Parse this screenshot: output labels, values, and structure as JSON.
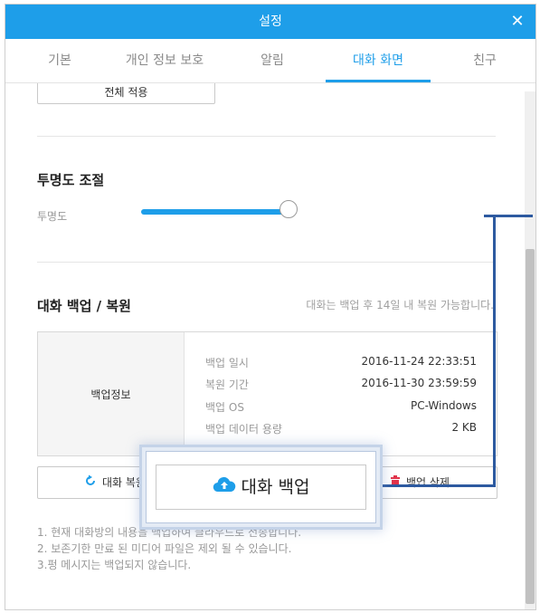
{
  "window": {
    "title": "설정",
    "close_glyph": "✕"
  },
  "tabs": [
    {
      "label": "기본",
      "active": false
    },
    {
      "label": "개인 정보 보호",
      "active": false
    },
    {
      "label": "알림",
      "active": false
    },
    {
      "label": "대화 화면",
      "active": true
    },
    {
      "label": "친구",
      "active": false
    }
  ],
  "apply_all_button": "전체 적용",
  "transparency": {
    "section_title": "투명도 조절",
    "label": "투명도",
    "level_fraction": 1.0
  },
  "backup": {
    "section_title": "대화 백업 / 복원",
    "note": "대화는 백업 후 14일 내 복원 가능합니다.",
    "info_title": "백업정보",
    "rows": [
      {
        "label": "백업 일시",
        "value": "2016-11-24 22:33:51"
      },
      {
        "label": "복원 기간",
        "value": "2016-11-30 23:59:59"
      },
      {
        "label": "백업 OS",
        "value": "PC-Windows"
      },
      {
        "label": "백업 데이터 용량",
        "value": "2 KB"
      }
    ],
    "restore_button": "대화 복원",
    "backup_button": "대화 백업",
    "delete_button": "백업 삭제",
    "footnotes": [
      "1. 현재 대화방의 내용을 백업하여 클라우드로 전송합니다.",
      "2. 보존기한 만료 된 미디어 파일은 제외 될 수 있습니다.",
      "3.펑 메시지는 백업되지 않습니다."
    ]
  },
  "colors": {
    "accent": "#1e9ee9",
    "delete_icon": "#e2334a",
    "highlight_connector": "#2d5aa0"
  },
  "icons": {
    "close": "close-icon",
    "restore": "restore-arrow-icon",
    "backup": "cloud-upload-icon",
    "delete": "trash-icon"
  }
}
